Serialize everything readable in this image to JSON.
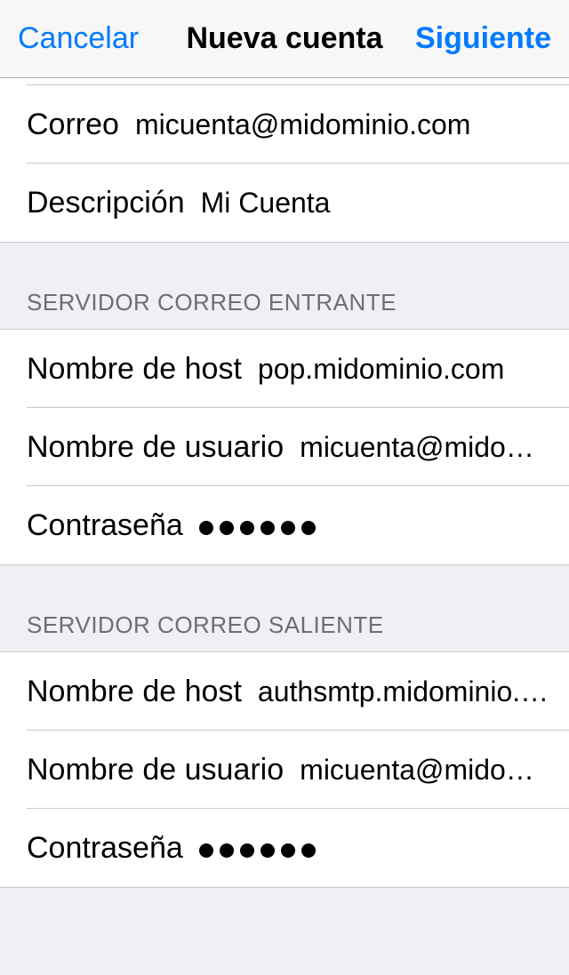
{
  "navbar": {
    "cancel": "Cancelar",
    "title": "Nueva cuenta",
    "next": "Siguiente"
  },
  "account": {
    "email_label": "Correo",
    "email_value": "micuenta@midominio.com",
    "description_label": "Descripción",
    "description_value": "Mi Cuenta"
  },
  "incoming": {
    "header": "SERVIDOR CORREO ENTRANTE",
    "host_label": "Nombre de host",
    "host_value": "pop.midominio.com",
    "user_label": "Nombre de usuario",
    "user_value": "micuenta@mido…",
    "password_label": "Contraseña",
    "password_value": "••••••"
  },
  "outgoing": {
    "header": "SERVIDOR CORREO SALIENTE",
    "host_label": "Nombre de host",
    "host_value": "authsmtp.midominio.…",
    "user_label": "Nombre de usuario",
    "user_value": "micuenta@mido…",
    "password_label": "Contraseña",
    "password_value": "••••••"
  }
}
